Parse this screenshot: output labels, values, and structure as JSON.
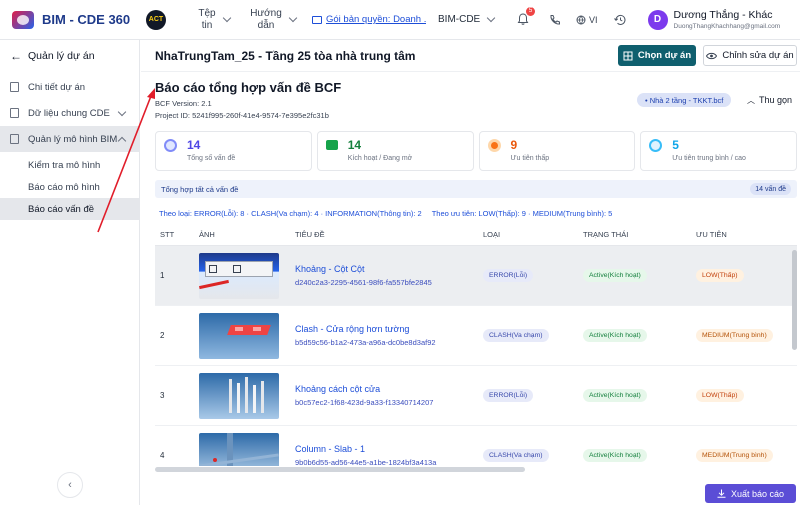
{
  "header": {
    "app_name": "BIM - CDE 360",
    "org_badge": "ACT",
    "nav": [
      {
        "label": "Tệp\ntin"
      },
      {
        "label": "Hướng\ndẫn"
      }
    ],
    "package_link": "Gói bản quyền: Doanh ...",
    "project_selector": "BIM-CDE",
    "notification_count": "5",
    "language": "VI",
    "user": {
      "initial": "D",
      "name": "Dương Thắng - Khác",
      "email": "DuongThangKhachhang@gmail.com"
    }
  },
  "sidebar": {
    "back_label": "Quản lý dự án",
    "items": [
      {
        "label": "Chi tiết dự án"
      },
      {
        "label": "Dữ liệu chung CDE"
      },
      {
        "label": "Quản lý mô hình BIM"
      }
    ],
    "sub_items": [
      {
        "label": "Kiểm tra mô hình"
      },
      {
        "label": "Báo cáo mô hình"
      },
      {
        "label": "Báo cáo vấn đề"
      }
    ],
    "collapse_glyph": "‹"
  },
  "page": {
    "title": "NhaTrungTam_25 - Tầng 25 tòa nhà trung tâm",
    "select_project_btn": "Chọn dự án",
    "edit_project_btn": "Chỉnh sửa dự án"
  },
  "report": {
    "title": "Báo cáo tổng hợp vấn đề BCF",
    "bcf_version": "BCF Version: 2.1",
    "project_id": "Project ID: 5241f995-260f-41e4-9574-7e395e2fc31b",
    "model_chip": "• Nhà 2 tầng - TKKT.bcf",
    "collapse_label": "Thu gọn"
  },
  "stats": [
    {
      "value": "14",
      "label": "Tổng số vấn đề",
      "color": "#4f46e5",
      "icon": "issues-icon"
    },
    {
      "value": "14",
      "label": "Kích hoạt / Đang mở",
      "color": "#15803d",
      "icon": "folder-open-icon"
    },
    {
      "value": "9",
      "label": "Ưu tiên thấp",
      "color": "#ea580c",
      "icon": "priority-low-icon"
    },
    {
      "value": "5",
      "label": "Ưu tiên trung bình / cao",
      "color": "#0ea5e9",
      "icon": "priority-medium-icon"
    }
  ],
  "summary": {
    "label": "Tổng hợp tất cả vấn đề",
    "count": "14 vấn đề",
    "type_filter": "Theo loại: ERROR(Lỗi): 8 · CLASH(Va chạm): 4 · INFORMATION(Thông tin): 2",
    "priority_filter": "Theo ưu tiên: LOW(Thấp): 9 · MEDIUM(Trung bình): 5"
  },
  "table": {
    "columns": [
      "STT",
      "ẢNH",
      "TIÊU ĐỀ",
      "LOẠI",
      "TRẠNG THÁI",
      "ƯU TIÊN"
    ],
    "rows": [
      {
        "stt": "1",
        "title": "Khoảng - Cột Cột",
        "id": "d240c2a3-2295-4561-98f6-fa557bfe2845",
        "type": "ERROR(Lỗi)",
        "status": "Active(Kích hoạt)",
        "priority": "LOW(Thấp)"
      },
      {
        "stt": "2",
        "title": "Clash - Cửa rộng hơn tường",
        "id": "b5d59c56-b1a2-473a-a96a-dc0be8d3af92",
        "type": "CLASH(Va chạm)",
        "status": "Active(Kích hoạt)",
        "priority": "MEDIUM(Trung bình)"
      },
      {
        "stt": "3",
        "title": "Khoảng cách cột cửa",
        "id": "b0c57ec2-1f68-423d-9a33-f13340714207",
        "type": "ERROR(Lỗi)",
        "status": "Active(Kích hoạt)",
        "priority": "LOW(Thấp)"
      },
      {
        "stt": "4",
        "title": "Column - Slab - 1",
        "id": "9b0b6d55-ad56-44e5-a1be-1824bf3a413a",
        "type": "CLASH(Va chạm)",
        "status": "Active(Kích hoạt)",
        "priority": "MEDIUM(Trung bình)"
      }
    ]
  },
  "export_btn": "Xuất báo cáo"
}
